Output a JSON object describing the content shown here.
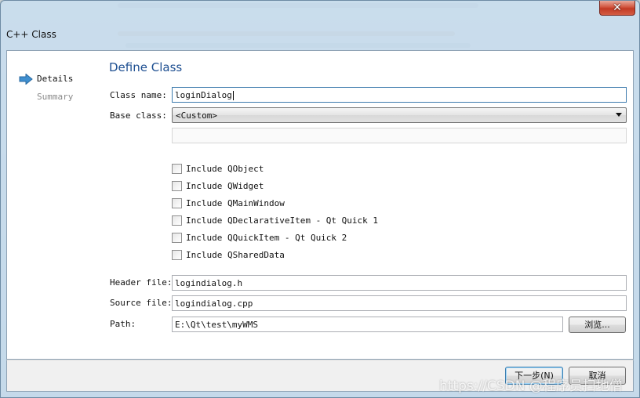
{
  "window": {
    "title": "C++ Class",
    "close_glyph": "✕"
  },
  "wizard_steps": [
    {
      "label": "Details",
      "active": true
    },
    {
      "label": "Summary",
      "active": false
    }
  ],
  "page_heading": "Define Class",
  "form": {
    "class_name_label": "Class name:",
    "class_name_value": "loginDialog",
    "base_class_label": "Base class:",
    "base_class_value": "<Custom>",
    "custom_base_value": "",
    "checkboxes": [
      {
        "label": "Include QObject",
        "checked": false
      },
      {
        "label": "Include QWidget",
        "checked": false
      },
      {
        "label": "Include QMainWindow",
        "checked": false
      },
      {
        "label": "Include QDeclarativeItem - Qt Quick 1",
        "checked": false
      },
      {
        "label": "Include QQuickItem - Qt Quick 2",
        "checked": false
      },
      {
        "label": "Include QSharedData",
        "checked": false
      }
    ],
    "header_file_label": "Header file:",
    "header_file_value": "logindialog.h",
    "source_file_label": "Source file:",
    "source_file_value": "logindialog.cpp",
    "path_label": "Path:",
    "path_value": "E:\\Qt\\test\\myWMS",
    "browse_label": "浏览..."
  },
  "footer": {
    "next_label": "下一步(N)",
    "cancel_label": "取消"
  },
  "watermark": "https://CSDN @程序员扫地僧",
  "colors": {
    "heading": "#1e4f91",
    "title_bar": "#c6dbec",
    "close_button": "#c23a24",
    "step_arrow": "#3f8fd0"
  }
}
